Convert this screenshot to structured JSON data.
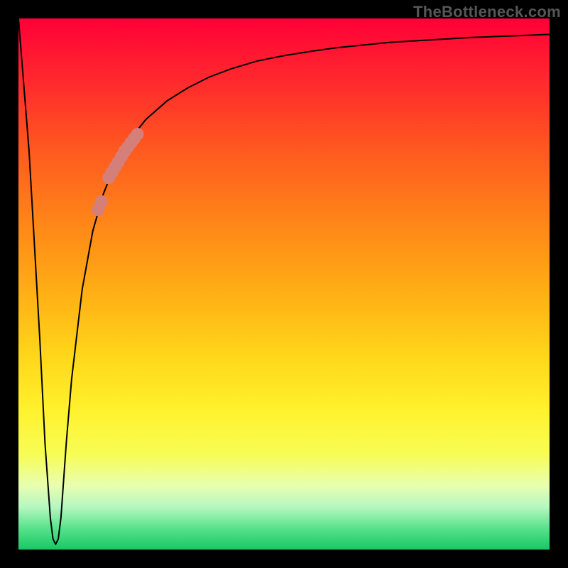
{
  "watermark": "TheBottleneck.com",
  "colors": {
    "frame": "#000000",
    "curve": "#000000",
    "marker": "#d57f7b",
    "watermark_text": "#565656"
  },
  "chart_data": {
    "type": "line",
    "title": "",
    "xlabel": "",
    "ylabel": "",
    "xlim": [
      0,
      100
    ],
    "ylim": [
      0,
      100
    ],
    "grid": false,
    "legend": false,
    "background": "rainbow-vertical-red-to-green",
    "series": [
      {
        "name": "bottleneck-curve",
        "x": [
          0,
          2,
          4,
          5,
          6,
          6.5,
          7,
          7.5,
          8,
          9,
          10,
          12,
          14,
          16,
          18,
          20,
          24,
          28,
          32,
          36,
          40,
          45,
          50,
          55,
          60,
          65,
          70,
          75,
          80,
          85,
          90,
          95,
          100
        ],
        "y": [
          100,
          75,
          40,
          20,
          6,
          2,
          1,
          2,
          6,
          20,
          32,
          49,
          60,
          67,
          72,
          76,
          81,
          84.5,
          87,
          89,
          90.5,
          92,
          93,
          93.8,
          94.5,
          95,
          95.5,
          95.8,
          96.1,
          96.4,
          96.6,
          96.8,
          97
        ],
        "color": "#000000",
        "stroke_width": 2
      }
    ],
    "markers": [
      {
        "name": "highlight-cluster",
        "color": "#d57f7b",
        "shape": "circle",
        "size": 9,
        "points": [
          {
            "x": 17.0,
            "y": 70.0
          },
          {
            "x": 17.6,
            "y": 71.0
          },
          {
            "x": 18.2,
            "y": 72.0
          },
          {
            "x": 18.8,
            "y": 73.0
          },
          {
            "x": 19.4,
            "y": 74.0
          },
          {
            "x": 20.0,
            "y": 75.0
          },
          {
            "x": 20.6,
            "y": 75.8
          },
          {
            "x": 21.2,
            "y": 76.6
          },
          {
            "x": 21.8,
            "y": 77.4
          },
          {
            "x": 22.4,
            "y": 78.2
          },
          {
            "x": 15.0,
            "y": 64.0
          },
          {
            "x": 15.6,
            "y": 65.5
          }
        ]
      }
    ]
  }
}
